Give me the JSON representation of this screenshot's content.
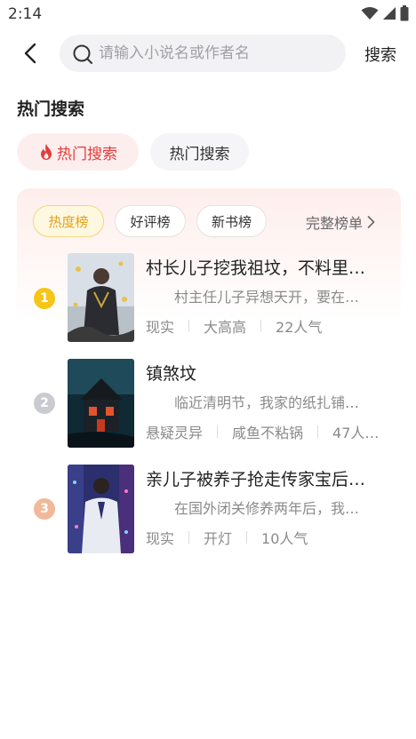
{
  "status_bar": {
    "time": "2:14"
  },
  "search": {
    "placeholder": "请输入小说名或作者名",
    "value": "",
    "button_label": "搜索"
  },
  "section_title": "热门搜索",
  "hot_chips": [
    {
      "label": "热门搜索",
      "icon": "flame-icon",
      "color": "#e53b3b"
    },
    {
      "label": "热门搜索"
    }
  ],
  "rank_tabs": [
    "热度榜",
    "好评榜",
    "新书榜"
  ],
  "full_list_label": "完整榜单",
  "books": [
    {
      "rank": "1",
      "rank_color": "#f5c518",
      "title": "村长儿子挖我祖坟，不料里面…",
      "desc": "村主任儿子异想天开，要在…",
      "meta": [
        "现实",
        "大高高",
        "22人气"
      ]
    },
    {
      "rank": "2",
      "rank_color": "#c9cbd0",
      "title": "镇煞坟",
      "desc": "临近清明节，我家的纸扎铺…",
      "meta": [
        "悬疑灵异",
        "咸鱼不粘锅",
        "47人…"
      ]
    },
    {
      "rank": "3",
      "rank_color": "#f1b99a",
      "title": "亲儿子被养子抢走传家宝后…",
      "desc": "在国外闭关修养两年后，我…",
      "meta": [
        "现实",
        "开灯",
        "10人气"
      ]
    }
  ],
  "colors": {
    "accent_red": "#e53b3b",
    "accent_gold": "#e0a21a"
  }
}
